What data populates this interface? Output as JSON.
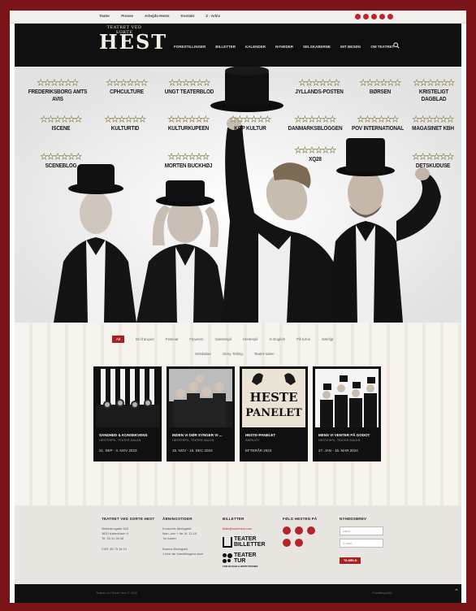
{
  "topbar": {
    "links": [
      "Teater",
      "Presse",
      "Arbejds-Hests",
      "Kontakt",
      "Z - Arkiv"
    ],
    "social_icons": [
      "facebook-icon",
      "instagram-icon",
      "pinterest-icon",
      "twitter-icon",
      "youtube-icon"
    ]
  },
  "header": {
    "logo_small": "TEATRET VED SORTE",
    "logo_big": "HEST",
    "nav": [
      "FORESTILLINGER",
      "BILLETTER",
      "KALENDER",
      "NYHEDER",
      "SELSKABERNE",
      "MIT BESØG",
      "OM TEATRET"
    ],
    "search_icon": "search-icon"
  },
  "hero": {
    "stars": "★★★★★★",
    "reviews": [
      "FREDERIKSBORG AMTS AVIS",
      "CPHCULTURE",
      "UNGT TEATERBLOD",
      "JYLLANDS-POSTEN",
      "BØRSEN",
      "KRISTELIGT DAGBLAD",
      "ISCENE",
      "KULTURTID",
      "KULTURKUPEEN",
      "KOP KULTUR",
      "DANMARKSBLOGGEN",
      "POV INTERNATIONAL",
      "MAGASINET KBH",
      "SCENEBLOG",
      "MORTEN BUCKHØJ",
      "XQ28",
      "DETSKUDUSE"
    ]
  },
  "filters": {
    "row1": [
      "Alt",
      "En français",
      "Festival",
      "Flyveren",
      "Gæstespil",
      "Hestespil",
      "In English",
      "På turné",
      "Særligt"
    ],
    "row2": [
      "Selskaber",
      "Story-Telling",
      "Teater-salen"
    ]
  },
  "shows": [
    {
      "title": "SANDHED & KONSEKVENS",
      "sub": "HESTESPIL, TEATER-SALEN",
      "date": "21. SEP - 4. NOV 2023"
    },
    {
      "title": "INDEN VI DØR SYNGER VI ...",
      "sub": "HESTESPIL, TEATER-SALEN",
      "date": "15. NOV - 16. DEC 2023"
    },
    {
      "title": "HESTE-PANELET",
      "sub": "SÆRLIGT",
      "date": "EFTERÅR 2023",
      "poster_text": [
        "HESTE",
        "PANELET"
      ]
    },
    {
      "title": "MENS VI VENTER PÅ GODOT",
      "sub": "HESTESPIL, TEATER-SALEN",
      "date": "27. JAN - 16. MAR 2024"
    }
  ],
  "footer": {
    "col1": {
      "heading": "TEATRET VED SORTE HEST",
      "lines": [
        "Vesterbrogade 150",
        "1620 København V",
        "Tlf. 33 31 06 06",
        "",
        "CVR. 82 75 34 12"
      ]
    },
    "col2": {
      "heading": "ÅBNINGSTIDER",
      "lines": [
        "Kontorets åbningstid",
        "Man.-ons + fre. kl. 11-15",
        "Tor lukket",
        "",
        "Barens åbningstid",
        "1 time før forestillingens start"
      ]
    },
    "col3": {
      "heading": "BILLETTER",
      "email": "billet@sortehest.com",
      "logo1": [
        "TEATER",
        "BILLETTER"
      ],
      "logo2": [
        "TEATER",
        "TUR"
      ],
      "logo2_sub": "FOR SKOLER & INSTITUTIONER"
    },
    "col4": {
      "heading": "FØLG HESTEN PÅ",
      "icons": [
        "facebook-icon",
        "linkedin-icon",
        "instagram-icon",
        "pinterest-icon",
        "twitter-icon"
      ]
    },
    "col5": {
      "heading": "NYHEDSBREV",
      "name_placeholder": "Navn",
      "email_placeholder": "E-mail",
      "button": "TILMELD"
    }
  },
  "bottom": {
    "copyright": "Teatret ved Sorte Hest © 2016",
    "privacy": "Privatlivspolitik",
    "up": "⌃"
  }
}
